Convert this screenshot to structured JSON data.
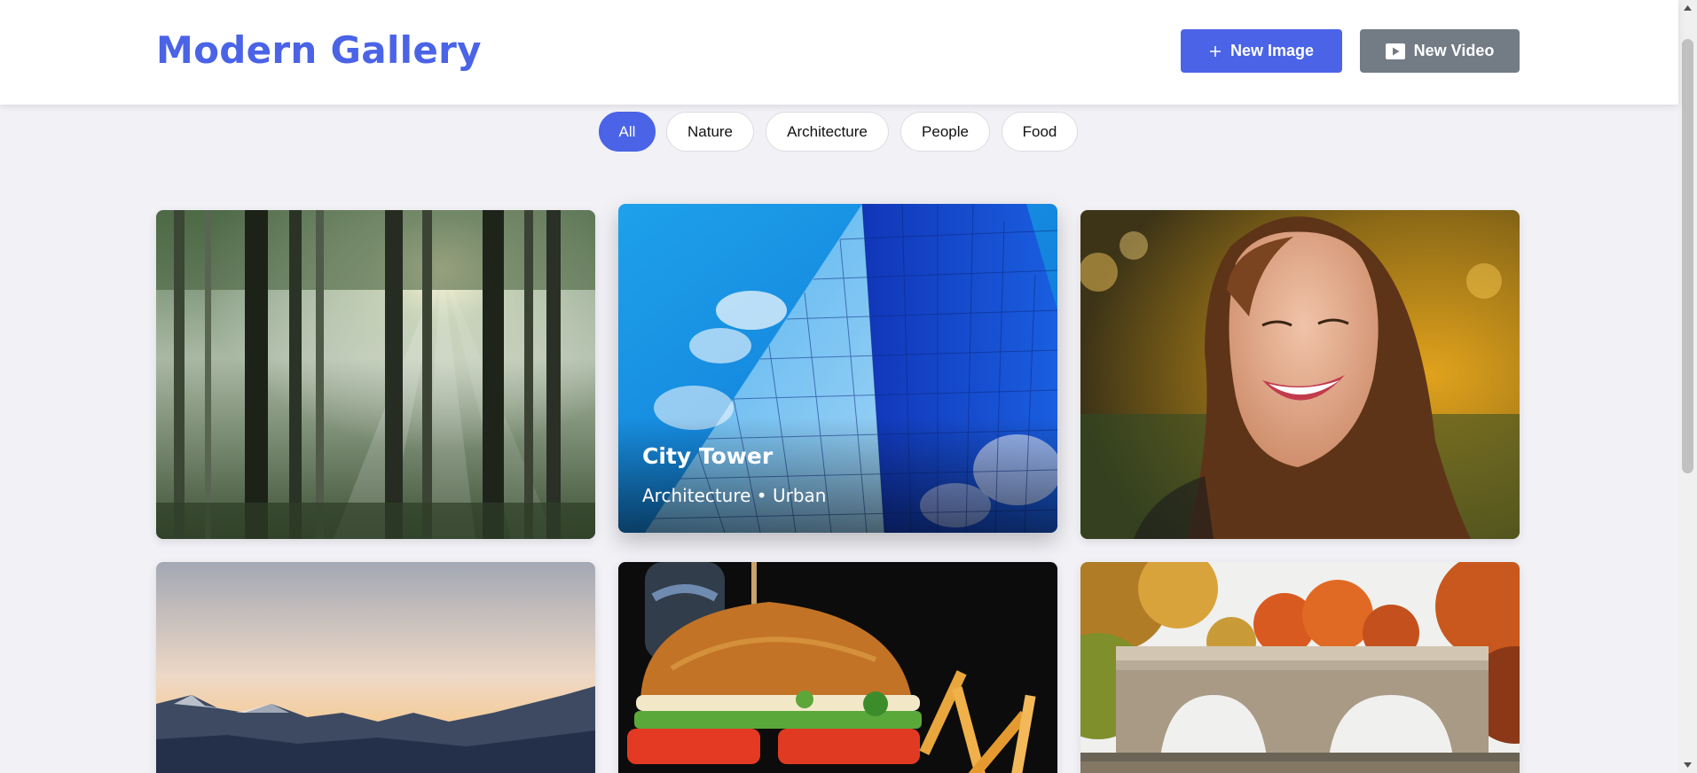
{
  "app": {
    "title": "Modern Gallery"
  },
  "header": {
    "new_image": {
      "label": "New Image",
      "icon": "plus-icon"
    },
    "new_video": {
      "label": "New Video",
      "icon": "video-play-icon"
    }
  },
  "filters": {
    "active": "All",
    "items": [
      {
        "label": "All"
      },
      {
        "label": "Nature"
      },
      {
        "label": "Architecture"
      },
      {
        "label": "People"
      },
      {
        "label": "Food"
      }
    ]
  },
  "gallery": {
    "items": [
      {
        "subject": "sunlit forest"
      },
      {
        "subject": "glass skyscraper",
        "title": "City Tower",
        "subtitle": "Architecture • Urban"
      },
      {
        "subject": "smiling woman"
      },
      {
        "subject": "mountain sunset"
      },
      {
        "subject": "burger and fries"
      },
      {
        "subject": "stone bridge in autumn"
      }
    ]
  },
  "colors": {
    "accent": "#4a63e7",
    "secondary_button": "#737b85",
    "background": "#f1f1f6",
    "header": "#ffffff"
  }
}
